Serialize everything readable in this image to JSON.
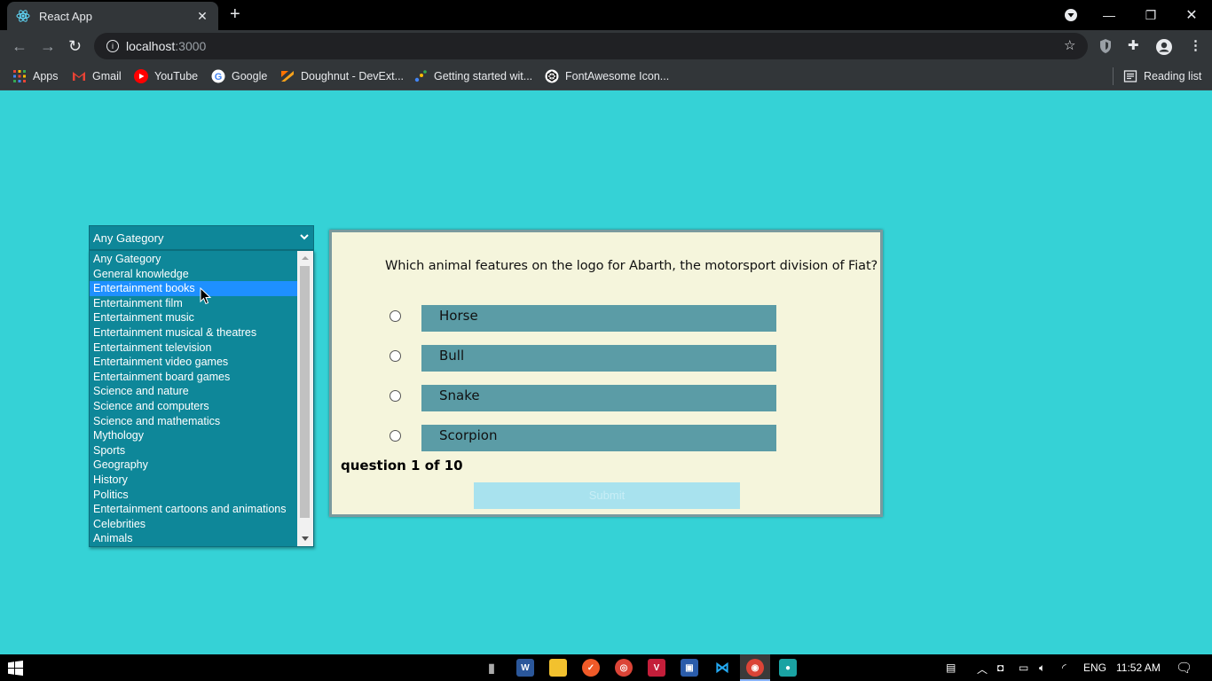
{
  "browser": {
    "tab_title": "React App",
    "url_host": "localhost",
    "url_port": ":3000",
    "bookmarks": [
      {
        "label": "Apps",
        "icon": "apps-grid-icon"
      },
      {
        "label": "Gmail",
        "icon": "gmail-icon"
      },
      {
        "label": "YouTube",
        "icon": "youtube-icon"
      },
      {
        "label": "Google",
        "icon": "google-icon"
      },
      {
        "label": "Doughnut - DevExt...",
        "icon": "devextreme-icon"
      },
      {
        "label": "Getting started wit...",
        "icon": "getting-started-icon"
      },
      {
        "label": "FontAwesome Icon...",
        "icon": "codepen-icon"
      }
    ],
    "reading_list": "Reading list"
  },
  "category_select": {
    "selected": "Any Gategory",
    "options": [
      "Any Gategory",
      "General knowledge",
      "Entertainment books",
      "Entertainment film",
      "Entertainment music",
      "Entertainment musical & theatres",
      "Entertainment television",
      "Entertainment video games",
      "Entertainment board games",
      "Science and nature",
      "Science and computers",
      "Science and mathematics",
      "Mythology",
      "Sports",
      "Geography",
      "History",
      "Politics",
      "Entertainment cartoons and animations",
      "Celebrities",
      "Animals"
    ],
    "highlighted_index": 2
  },
  "quiz": {
    "question": "Which animal features on the logo for Abarth, the motorsport division of Fiat?",
    "answers": [
      "Horse",
      "Bull",
      "Snake",
      "Scorpion"
    ],
    "progress": "question 1 of 10",
    "submit_label": "Submit"
  },
  "taskbar": {
    "language": "ENG",
    "time": "11:52 AM"
  },
  "colors": {
    "page_background": "#35d2d6",
    "select_background": "#0e8799",
    "highlight": "#1e90ff",
    "card_background": "#f5f5dc",
    "answer_background": "#5b9ca6"
  }
}
